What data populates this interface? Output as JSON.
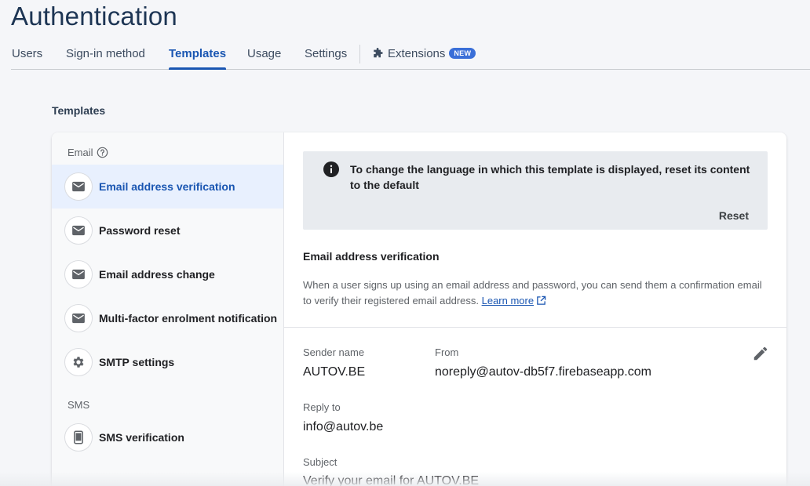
{
  "page": {
    "title": "Authentication"
  },
  "tabs": [
    {
      "label": "Users"
    },
    {
      "label": "Sign-in method"
    },
    {
      "label": "Templates"
    },
    {
      "label": "Usage"
    },
    {
      "label": "Settings"
    },
    {
      "label": "Extensions",
      "badge": "NEW"
    }
  ],
  "section": {
    "title": "Templates"
  },
  "sidebar": {
    "email_group": "Email",
    "sms_group": "SMS",
    "items": [
      {
        "label": "Email address verification",
        "icon": "mail-icon"
      },
      {
        "label": "Password reset",
        "icon": "mail-icon"
      },
      {
        "label": "Email address change",
        "icon": "mail-icon"
      },
      {
        "label": "Multi-factor enrolment notification",
        "icon": "mail-icon"
      },
      {
        "label": "SMTP settings",
        "icon": "gear-icon"
      },
      {
        "label": "SMS verification",
        "icon": "phone-icon"
      }
    ]
  },
  "info": {
    "text": "To change the language in which this template is displayed, reset its content to the default",
    "reset_label": "Reset"
  },
  "template": {
    "title": "Email address verification",
    "description": "When a user signs up using an email address and password, you can send them a confirmation email to verify their registered email address.",
    "learn_more": "Learn more",
    "sender_name_label": "Sender name",
    "sender_name": "AUTOV.BE",
    "from_label": "From",
    "from": "noreply@autov-db5f7.firebaseapp.com",
    "reply_to_label": "Reply to",
    "reply_to": "info@autov.be",
    "subject_label": "Subject",
    "subject": "Verify your email for AUTOV.BE"
  },
  "colors": {
    "accent": "#1a56b2",
    "title": "#1d3554",
    "badge": "#3a6fd8"
  }
}
